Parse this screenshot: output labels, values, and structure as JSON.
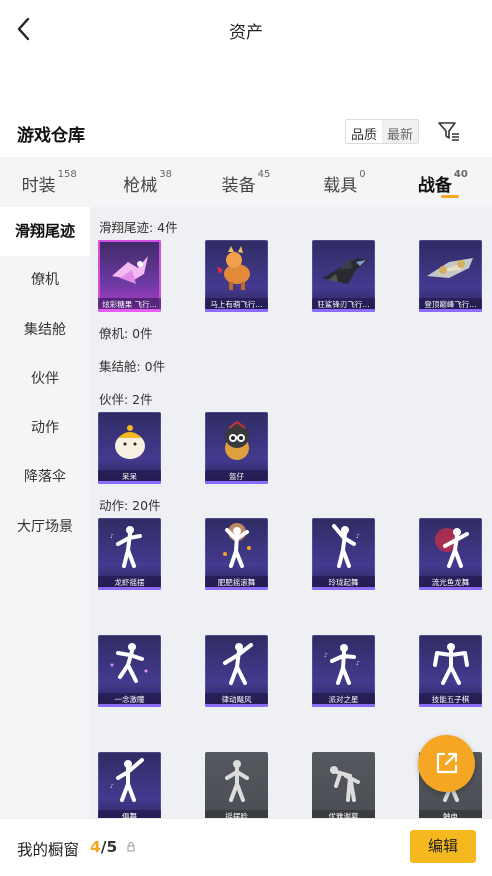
{
  "header": {
    "title": "资产"
  },
  "warehouse": {
    "title": "游戏仓库",
    "sort_options": [
      "品质",
      "最新"
    ],
    "active_sort": 1
  },
  "tabs": [
    {
      "label": "时装",
      "count": "158"
    },
    {
      "label": "枪械",
      "count": "38"
    },
    {
      "label": "装备",
      "count": "45"
    },
    {
      "label": "载具",
      "count": "0"
    },
    {
      "label": "战备",
      "count": "40",
      "active": true
    }
  ],
  "sidebar": [
    {
      "label": "滑翔尾迹",
      "active": true
    },
    {
      "label": "僚机"
    },
    {
      "label": "集结舱"
    },
    {
      "label": "伙伴"
    },
    {
      "label": "动作"
    },
    {
      "label": "降落伞"
    },
    {
      "label": "大厅场景"
    }
  ],
  "sections": {
    "trail": {
      "title": "滑翔尾迹: 4件",
      "items": [
        "炫彩糖果 飞行...",
        "马上有萌飞行...",
        "狂鲨锋刃飞行...",
        "登顶巅峰飞行..."
      ]
    },
    "wingman": {
      "title": "僚机: 0件"
    },
    "pod": {
      "title": "集结舱: 0件"
    },
    "partner": {
      "title": "伙伴: 2件",
      "items": [
        "呆呆",
        "盔仔"
      ]
    },
    "emote": {
      "title": "动作: 20件",
      "items": [
        "龙虾摇摆",
        "肥肥摇滚舞",
        "玲珑起舞",
        "流光鱼龙舞",
        "一念激瞳",
        "律动飓风",
        "派对之星",
        "技能五子棋",
        "俱舞",
        "摇摆脸",
        "优雅谢幕",
        "触电"
      ]
    }
  },
  "bottom": {
    "label": "我的橱窗",
    "current": "4",
    "total": "/5",
    "edit_label": "编辑"
  },
  "colors": {
    "accent": "#f5a623",
    "card_bg": "#3a3478",
    "rare_border": "#d14fe3"
  }
}
